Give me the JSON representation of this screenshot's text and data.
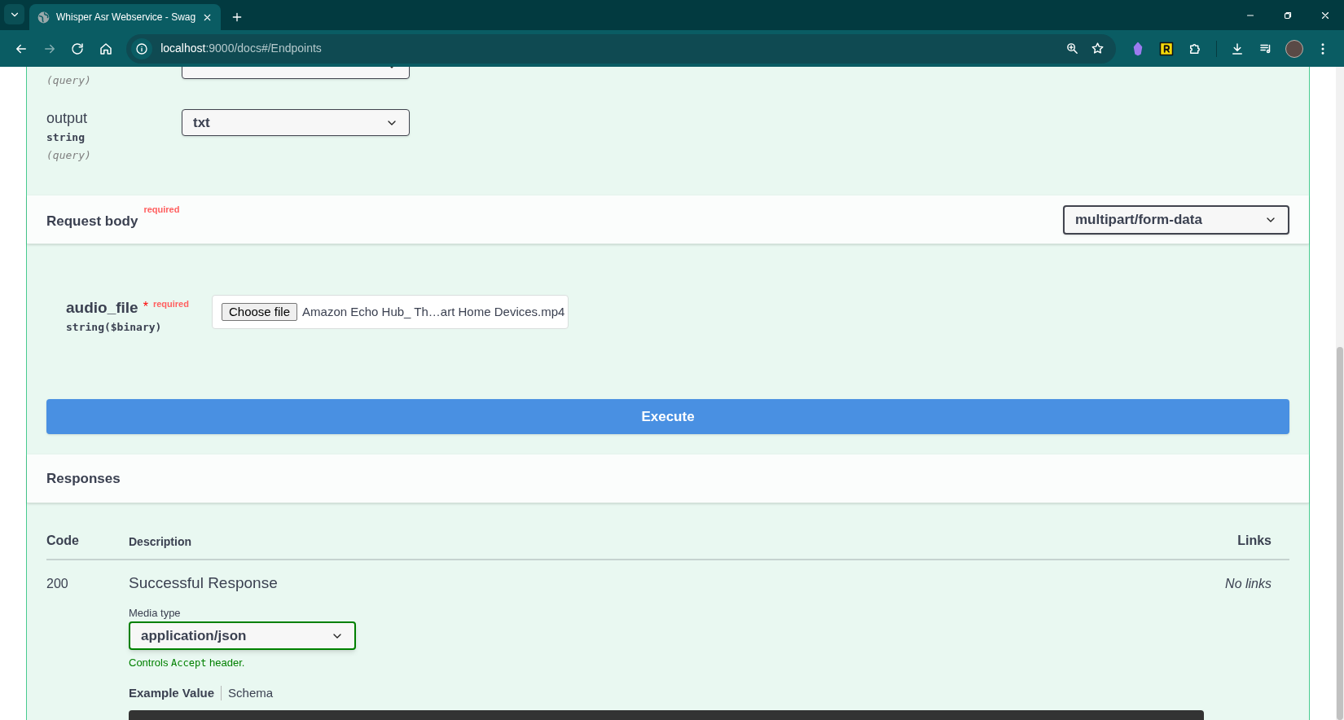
{
  "browser": {
    "tabs": [
      {
        "title": "Whisper Asr Webservice - Swag",
        "selected": true
      }
    ],
    "url": {
      "host": "localhost",
      "path": ":9000/docs#/Endpoints"
    }
  },
  "parameters": [
    {
      "location": "(query)"
    },
    {
      "name": "output",
      "type": "string",
      "location": "(query)",
      "value": "txt"
    }
  ],
  "request_body": {
    "title": "Request body",
    "required_note": "required",
    "content_type": "multipart/form-data",
    "fields": [
      {
        "name": "audio_file",
        "required_mark": "*",
        "required_note": "required",
        "type": "string($binary)",
        "button": "Choose file",
        "file_name": "Amazon Echo Hub_ Th…art Home Devices.mp4"
      }
    ]
  },
  "execute_button": "Execute",
  "responses": {
    "title": "Responses",
    "columns": [
      "Code",
      "Description",
      "Links"
    ],
    "rows": [
      {
        "code": "200",
        "description": "Successful Response",
        "media_type_label": "Media type",
        "media_type": "application/json",
        "controls_note": {
          "before": "Controls",
          "code": "Accept",
          "after": "header."
        },
        "links": "No links",
        "example_tabs": [
          {
            "label": "Example Value",
            "selected": true
          },
          {
            "label": "Schema",
            "selected": false
          }
        ]
      }
    ]
  }
}
